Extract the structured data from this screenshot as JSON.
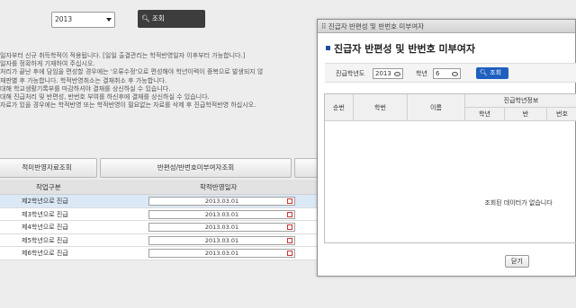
{
  "background": {
    "year_value": "2013",
    "search_label": "조회",
    "notices": [
      "일자부터 신규 취득학적이 적용됩니다. [일일 출결관리는 학적반영일자 이후부터 가능합니다.]",
      "일자를 정확하게 기재하여 주십시오.",
      "처리가 끝난 후에 담임을 편성할 경우에는 '오류수정'으로 편성해야 학년이력이 중복으로 발생되지 않",
      "재판별 후 가능합니다. 학적반영취소는 결재취소 후 가능합니다.",
      "대해 학교생활기록부를 마감하셔야 결재를 상신하실 수 있습니다.",
      "대해 진급처리 및 반편성, 반번호 부여를 하신후에 결재를 상신하실 수 있습니다.",
      "자료가 있을 경우에는 학적반영 또는 학적반영이 필요없는 자료를 삭제 후 진급학적반영 하십시오."
    ],
    "tab_reflect": "적미반영자료조회",
    "tab_class": "반편성/반번호미부여자조회",
    "table_headers": [
      "작업구분",
      "학적반영일자"
    ],
    "rows": [
      {
        "label": "제2학년으로 진급",
        "date": "2013.03.01"
      },
      {
        "label": "제3학년으로 진급",
        "date": "2013.03.01"
      },
      {
        "label": "제4학년으로 진급",
        "date": "2013.03.01"
      },
      {
        "label": "제5학년으로 진급",
        "date": "2013.03.01"
      },
      {
        "label": "제6학년으로 진급",
        "date": "2013.03.01"
      }
    ]
  },
  "popup": {
    "window_title": "진급자 반편성 및 반번호 미부여자",
    "heading": "진급자 반편성 및 반번호 미부여자",
    "filter_year_label": "진급학년도",
    "filter_year_value": "2013",
    "filter_grade_label": "학년",
    "filter_grade_value": "6",
    "search_label": "조회",
    "columns": {
      "no": "순번",
      "student_id": "학번",
      "name": "이름",
      "group": "진급학년정보",
      "grade": "학년",
      "class": "반",
      "number": "번호"
    },
    "empty_message": "조회된 데이터가 없습니다",
    "close_label": "닫기"
  },
  "colors": {
    "accent": "#1f5fbf",
    "selected_row": "#dbe8f6"
  }
}
